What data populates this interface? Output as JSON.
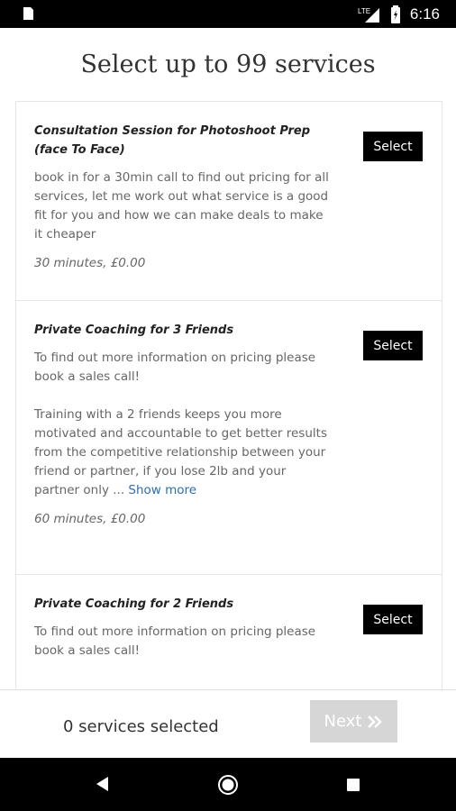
{
  "status_bar": {
    "time": "6:16",
    "network": "LTE"
  },
  "header": {
    "title": "Select up to 99 services"
  },
  "services": [
    {
      "title": "Consultation Session for Photoshoot Prep (face To Face)",
      "description": [
        "book in for a 30min call to find out pricing for all services, let me work out what service is a good fit for you and how we can make deals to make it cheaper"
      ],
      "meta": "30 minutes, £0.00",
      "select_label": "Select"
    },
    {
      "title": "Private Coaching for 3 Friends",
      "description": [
        "To find out more information on pricing please book a sales call!",
        "Training with a 2 friends keeps you more motivated and accountable to get better results from the competitive relationship between your friend or partner, if you lose 2lb and your partner only ..."
      ],
      "show_more": "Show more",
      "meta": "60 minutes, £0.00",
      "select_label": "Select"
    },
    {
      "title": "Private Coaching for 2 Friends",
      "description": [
        "To find out more information on pricing please book a sales call!"
      ],
      "select_label": "Select"
    }
  ],
  "footer": {
    "count_text": "0 services selected",
    "next_label": "Next",
    "next_icon": "double-chevron-right-icon"
  },
  "colors": {
    "select_button_bg": "#000000",
    "next_button_disabled_bg": "#d6d6d6",
    "link": "#2a6fb0"
  }
}
